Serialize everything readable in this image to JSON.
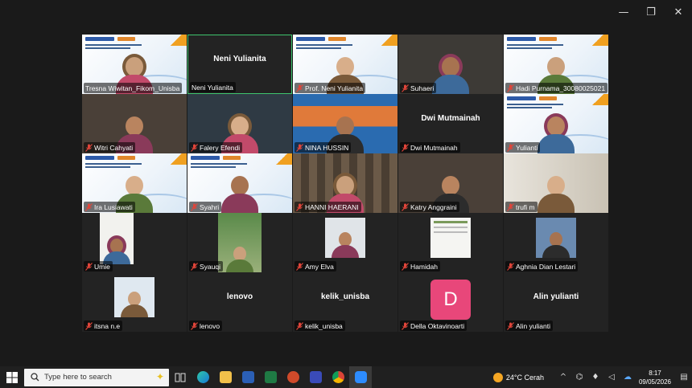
{
  "window": {
    "minimize": "—",
    "maximize": "❐",
    "close": "✕"
  },
  "tiles": [
    {
      "name": "Tresna Wiwitan_Fikom_Unisba",
      "type": "slide",
      "muted": false
    },
    {
      "name": "Neni Yulianita",
      "type": "text",
      "display": "Neni Yulianita",
      "muted": false,
      "active": true
    },
    {
      "name": "Prof. Neni Yulianita",
      "type": "slide",
      "muted": true
    },
    {
      "name": "Suhaeri",
      "type": "video",
      "muted": true
    },
    {
      "name": "Hadi Purnama_30080025021",
      "type": "slide",
      "muted": true
    },
    {
      "name": "Witri Cahyati",
      "type": "video",
      "muted": true
    },
    {
      "name": "Falery Efendi",
      "type": "video",
      "muted": true
    },
    {
      "name": "NINA HUSSIN",
      "type": "video",
      "muted": true
    },
    {
      "name": "Dwi Mutmainah",
      "type": "text",
      "display": "Dwi Mutmainah",
      "muted": true
    },
    {
      "name": "Yulianti",
      "type": "slide",
      "muted": true
    },
    {
      "name": "Ira Lusiawati",
      "type": "slide",
      "muted": true
    },
    {
      "name": "Syahri",
      "type": "slide",
      "muted": true
    },
    {
      "name": "HANNI HAERANI",
      "type": "video",
      "muted": true
    },
    {
      "name": "Katry Anggraini",
      "type": "video",
      "muted": true
    },
    {
      "name": "trufi m",
      "type": "video",
      "muted": true
    },
    {
      "name": "Umie",
      "type": "small",
      "muted": true
    },
    {
      "name": "Syauqi",
      "type": "small",
      "muted": true
    },
    {
      "name": "Amy Elva",
      "type": "small",
      "muted": true
    },
    {
      "name": "Hamidah",
      "type": "small",
      "muted": true
    },
    {
      "name": "Aghnia Dian Lestari",
      "type": "small",
      "muted": true
    },
    {
      "name": "itsna n.e",
      "type": "small",
      "muted": true
    },
    {
      "name": "lenovo",
      "type": "text",
      "display": "lenovo",
      "muted": true
    },
    {
      "name": "kelik_unisba",
      "type": "text",
      "display": "kelik_unisba",
      "muted": true
    },
    {
      "name": "Della Oktavinoarti",
      "type": "avatar",
      "display": "D",
      "muted": true
    },
    {
      "name": "Alin yulianti",
      "type": "text",
      "display": "Alin yulianti",
      "muted": true
    }
  ],
  "taskbar": {
    "search_placeholder": "Type here to search",
    "weather": "24°C  Cerah",
    "time": "8:17",
    "date": "09/05/2026"
  },
  "colors": {
    "active_border": "#3ec46d",
    "mute_red": "#e0453a",
    "avatar_pink": "#e8477a"
  }
}
